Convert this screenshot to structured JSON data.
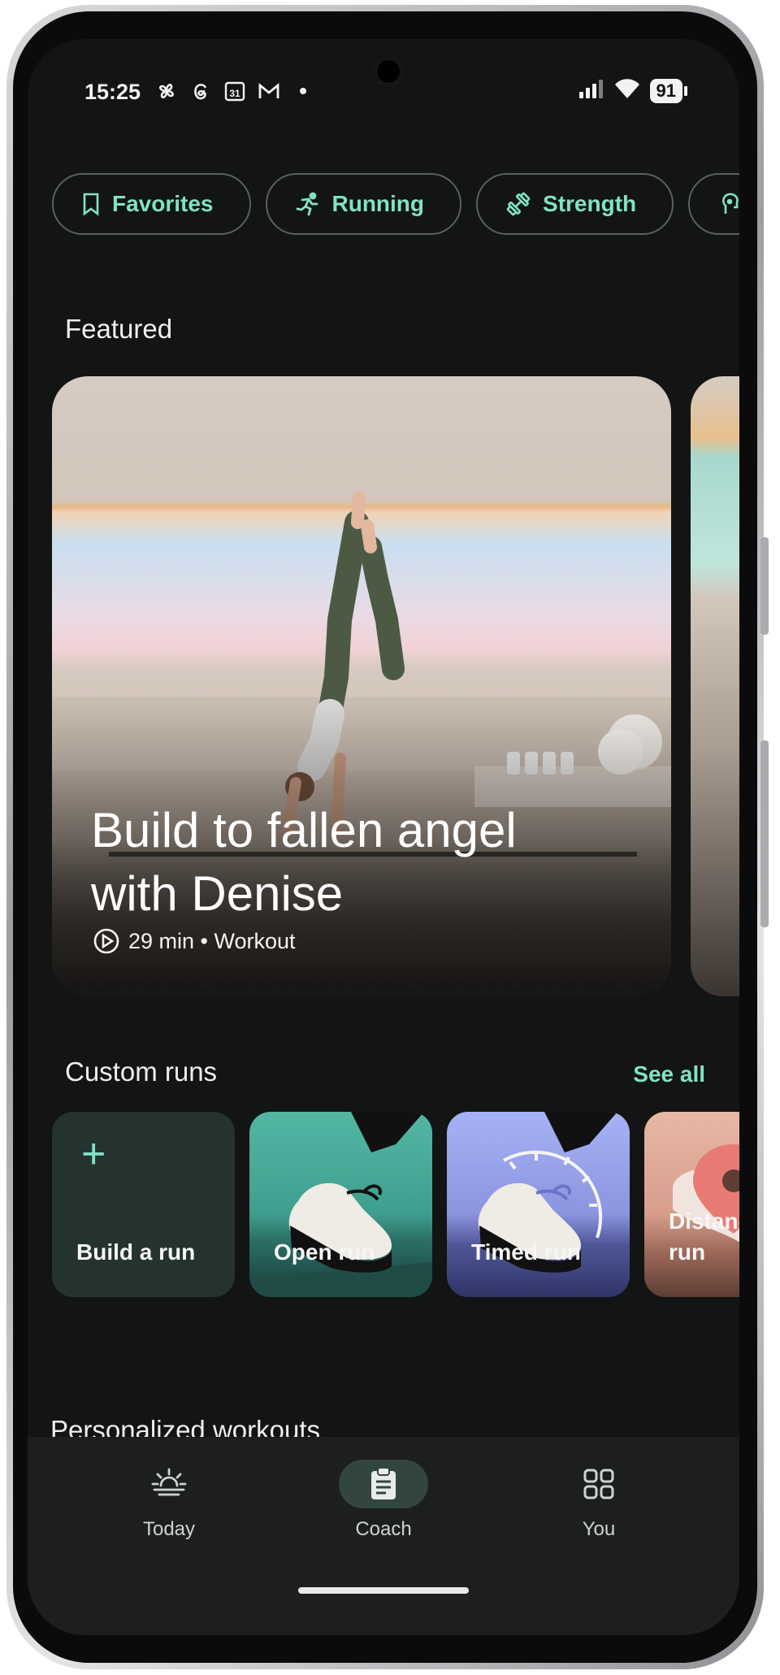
{
  "status_bar": {
    "time": "15:25",
    "battery": "91"
  },
  "chips": [
    {
      "label": "Favorites",
      "icon": "bookmark-icon"
    },
    {
      "label": "Running",
      "icon": "running-icon"
    },
    {
      "label": "Strength",
      "icon": "dumbbell-icon"
    },
    {
      "label": "",
      "icon": "meditation-icon"
    }
  ],
  "featured": {
    "section_title": "Featured",
    "card": {
      "title": "Build to fallen angel with Denise",
      "meta": "29 min • Workout"
    }
  },
  "custom_runs": {
    "section_title": "Custom runs",
    "see_all": "See all",
    "items": [
      {
        "label": "Build a run",
        "icon": "plus-icon"
      },
      {
        "label": "Open run",
        "icon": "shoe-icon"
      },
      {
        "label": "Timed run",
        "icon": "shoe-timer-icon"
      },
      {
        "label": "Distance run",
        "icon": "map-pin-icon"
      }
    ]
  },
  "personalized": {
    "section_title": "Personalized workouts"
  },
  "bottom_nav": [
    {
      "label": "Today",
      "icon": "sunrise-icon"
    },
    {
      "label": "Coach",
      "icon": "clipboard-icon",
      "selected": true
    },
    {
      "label": "You",
      "icon": "grid-icon"
    }
  ],
  "colors": {
    "accent": "#7fe3c4",
    "background": "#131414",
    "nav_background": "#1d1f1f"
  }
}
